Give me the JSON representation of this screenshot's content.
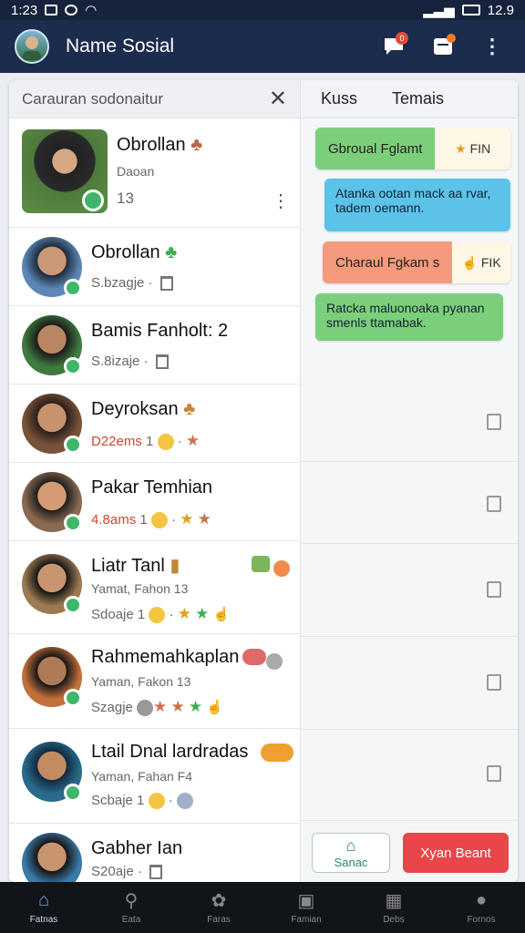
{
  "status": {
    "time": "1:23",
    "battery": "12.9"
  },
  "appbar": {
    "title": "Name Sosial"
  },
  "search": {
    "placeholder": "Carauran sodonaitur"
  },
  "tabs": [
    "Kuss",
    "Temais"
  ],
  "contacts": [
    {
      "name": "Obrollan",
      "sub1": "Daoan",
      "sub2": "13"
    },
    {
      "name": "Obrollan",
      "sub": "S.bzagje"
    },
    {
      "name": "Bamis Fanholt: 2",
      "sub": "S.8izaje"
    },
    {
      "name": "Deyroksan",
      "sub": "D22ems",
      "num": "1"
    },
    {
      "name": "Pakar Temhian",
      "sub": "4.8ams",
      "num": "1"
    },
    {
      "name": "Liatr Tanl",
      "sub1": "Yamat, Fahon 13",
      "sub": "Sdoaje",
      "num": "1"
    },
    {
      "name": "Rahmemahkaplan",
      "sub1": "Yaman, Fakon 13",
      "sub": "Szagje"
    },
    {
      "name": "Ltail Dnal lardradas",
      "sub1": "Yaman, Fahan F4",
      "sub": "Scbaje",
      "num": "1"
    },
    {
      "name": "Gabher Ian",
      "sub": "S20aje"
    }
  ],
  "messages": [
    {
      "left": "Gbroual Fglamt",
      "right": "FIN"
    },
    {
      "text": "Atanka ootan mack aa rvar, tadem oemann."
    },
    {
      "left": "Charaul Fgkam s",
      "right": "FIK"
    },
    {
      "text": "Ratcka maluonoaka pyanan smenls ttamabak."
    }
  ],
  "buttons": {
    "save": "Sanac",
    "danger": "Xyan Beant"
  },
  "nav": [
    "Fatnas",
    "Eata",
    "Faras",
    "Famian",
    "Debs",
    "Fornos"
  ],
  "colors": {
    "appbar": "#1b2c4c",
    "green": "#7ccf7a",
    "blue": "#5cc2e8",
    "salmon": "#f59a7c",
    "danger": "#e8464a"
  }
}
